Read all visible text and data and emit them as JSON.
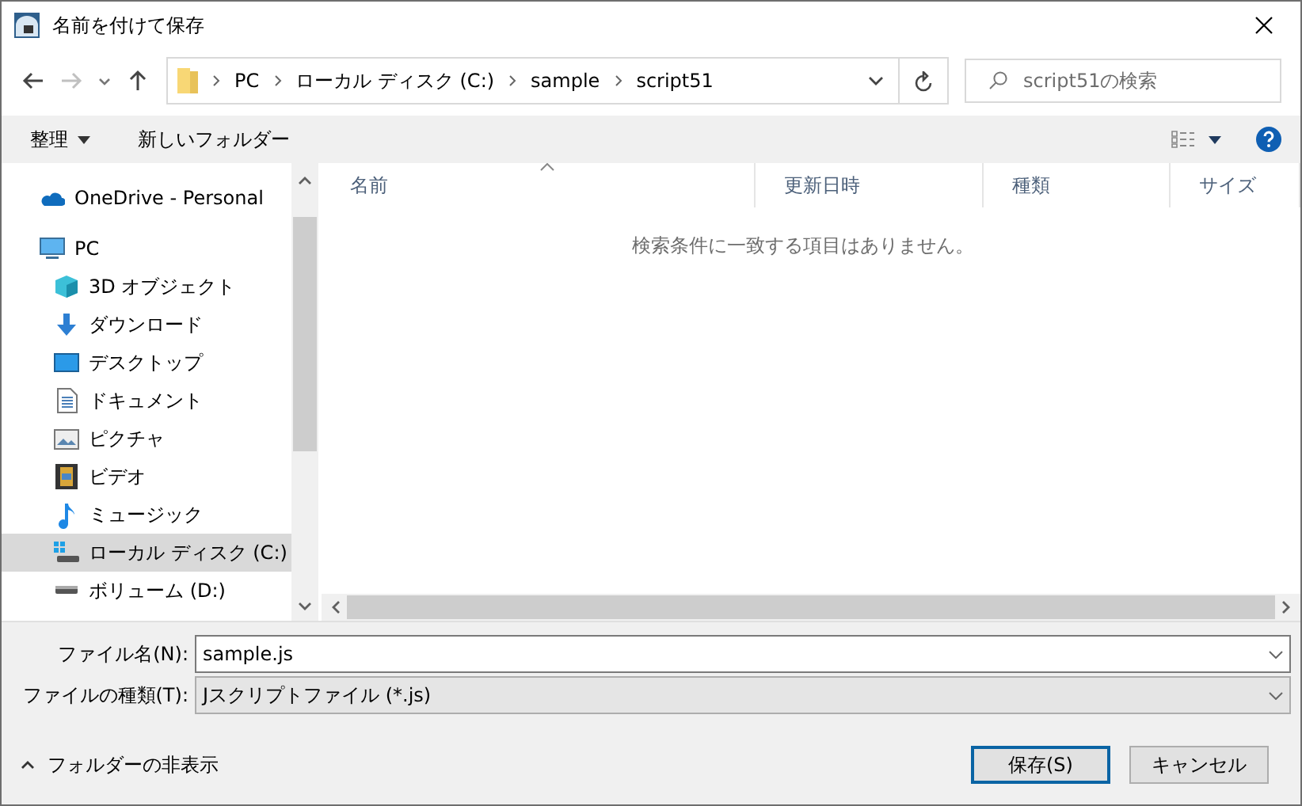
{
  "window": {
    "title": "名前を付けて保存"
  },
  "navigation": {
    "back": {
      "disabled": false
    },
    "forward": {
      "disabled": true
    },
    "up": {
      "disabled": false
    }
  },
  "address": {
    "path": [
      "PC",
      "ローカル ディスク (C:)",
      "sample",
      "script51"
    ]
  },
  "search": {
    "placeholder": "script51の検索"
  },
  "toolbar": {
    "organize": "整理",
    "new_folder": "新しいフォルダー"
  },
  "sidebar": {
    "items": [
      {
        "label": "OneDrive - Personal",
        "kind": "onedrive",
        "selected": false
      },
      {
        "label": "PC",
        "kind": "pc",
        "selected": false,
        "children": [
          {
            "label": "3D オブジェクト",
            "kind": "objects3d",
            "selected": false
          },
          {
            "label": "ダウンロード",
            "kind": "download",
            "selected": false
          },
          {
            "label": "デスクトップ",
            "kind": "desktop",
            "selected": false
          },
          {
            "label": "ドキュメント",
            "kind": "document",
            "selected": false
          },
          {
            "label": "ピクチャ",
            "kind": "pictures",
            "selected": false
          },
          {
            "label": "ビデオ",
            "kind": "video",
            "selected": false
          },
          {
            "label": "ミュージック",
            "kind": "music",
            "selected": false
          },
          {
            "label": "ローカル ディスク (C:)",
            "kind": "systemdrive",
            "selected": true
          },
          {
            "label": "ボリューム (D:)",
            "kind": "drive",
            "selected": false
          }
        ]
      }
    ]
  },
  "table": {
    "columns": [
      {
        "label": "名前",
        "sorted": true
      },
      {
        "label": "更新日時",
        "sorted": false
      },
      {
        "label": "種類",
        "sorted": false
      },
      {
        "label": "サイズ",
        "sorted": false
      }
    ],
    "empty_message": "検索条件に一致する項目はありません。"
  },
  "form": {
    "filename_label": "ファイル名(N):",
    "filename": "sample.js",
    "type_label": "ファイルの種類(T):",
    "type": "Jスクリプトファイル (*.js)"
  },
  "hide_folders": "フォルダーの非表示",
  "buttons": [
    {
      "label": "保存(S)",
      "default": true
    },
    {
      "label": "キャンセル",
      "default": false
    }
  ]
}
